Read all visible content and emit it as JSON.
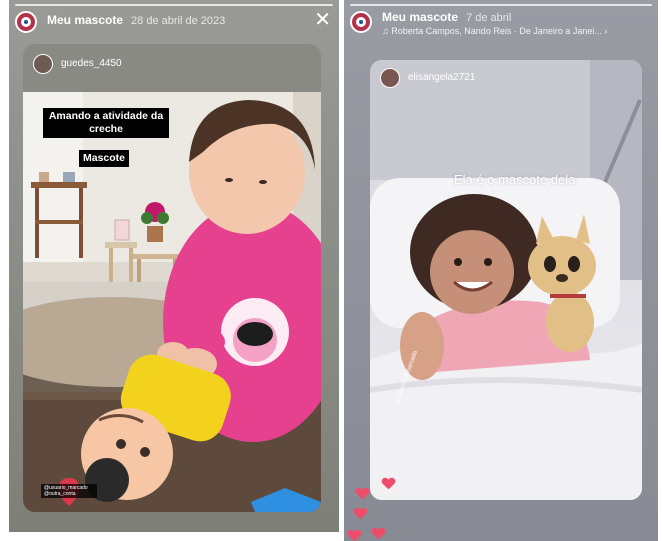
{
  "colors": {
    "progress_bar": "#ffffff",
    "sticker_background": "#000000",
    "heart": "#ef4c6a",
    "account_avatar": "#b3324a"
  },
  "left_story": {
    "account_name": "Meu mascote",
    "date": "28 de abril de 2023",
    "close_icon": "close-icon",
    "shared_post": {
      "username": "guedes_4450",
      "caption_line1": "Amando a atividade da creche",
      "caption_line2": "Mascote",
      "mention_tag": "@usuario_marcado @outra_conta"
    }
  },
  "right_story": {
    "account_name": "Meu mascote",
    "date": "7 de abril",
    "music_line": "Roberta Campos, Nando Reis · De Janeiro a Janei... ›",
    "music_icon": "music-note-icon",
    "shared_post": {
      "username": "elisangela2721",
      "caption": "Ela é o mascote dela",
      "mention_tag": "@usuaria @marcada"
    },
    "reaction_icons": [
      "heart-icon",
      "heart-icon",
      "heart-icon",
      "heart-icon",
      "heart-icon"
    ]
  }
}
